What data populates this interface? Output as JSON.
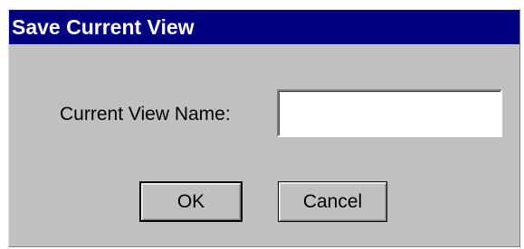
{
  "dialog": {
    "title": "Save Current View",
    "field_label": "Current View Name:",
    "field_value": "",
    "field_placeholder": "",
    "ok_label": "OK",
    "cancel_label": "Cancel"
  },
  "colors": {
    "title_bar": "#000080",
    "dialog_face": "#c0c0c0",
    "title_text": "#ffffff"
  }
}
